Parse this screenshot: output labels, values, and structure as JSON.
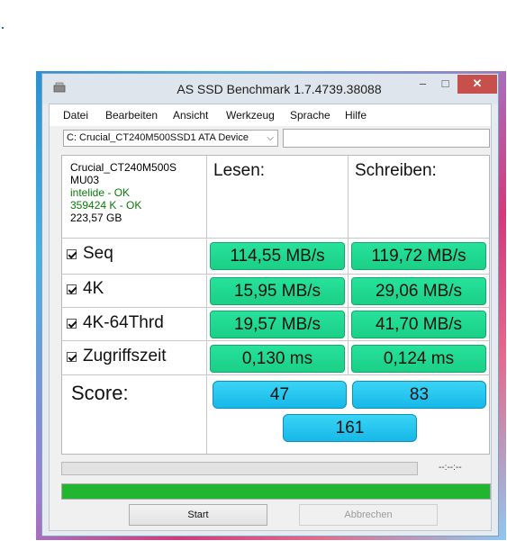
{
  "window": {
    "title": "AS SSD Benchmark 1.7.4739.38088",
    "min_glyph": "–",
    "max_glyph": "□",
    "close_glyph": "✕"
  },
  "menu": [
    "Datei",
    "Bearbeiten",
    "Ansicht",
    "Werkzeug",
    "Sprache",
    "Hilfe"
  ],
  "drive": {
    "selected": "C: Crucial_CT240M500SSD1 ATA Device",
    "extra_field": ""
  },
  "info": {
    "model": "Crucial_CT240M500S",
    "firmware": "MU03",
    "driver": "intelide - OK",
    "alignment": "359424 K - OK",
    "size": "223,57 GB"
  },
  "headers": {
    "read": "Lesen:",
    "write": "Schreiben:"
  },
  "rows": [
    {
      "label": "Seq",
      "read": "114,55 MB/s",
      "write": "119,72 MB/s",
      "checked": true
    },
    {
      "label": "4K",
      "read": "15,95 MB/s",
      "write": "29,06 MB/s",
      "checked": true
    },
    {
      "label": "4K-64Thrd",
      "read": "19,57 MB/s",
      "write": "41,70 MB/s",
      "checked": true
    },
    {
      "label": "Zugriffszeit",
      "read": "0,130 ms",
      "write": "0,124 ms",
      "checked": true
    }
  ],
  "score": {
    "label": "Score:",
    "read": "47",
    "write": "83",
    "total": "161"
  },
  "progress": {
    "timer": "--:--:--",
    "fraction": 1.0
  },
  "buttons": {
    "start": "Start",
    "cancel": "Abbrechen"
  },
  "colors": {
    "result_green": "#27e29b",
    "score_blue": "#3ad4f5",
    "progress_green": "#21b531",
    "close_red": "#c7504c"
  }
}
